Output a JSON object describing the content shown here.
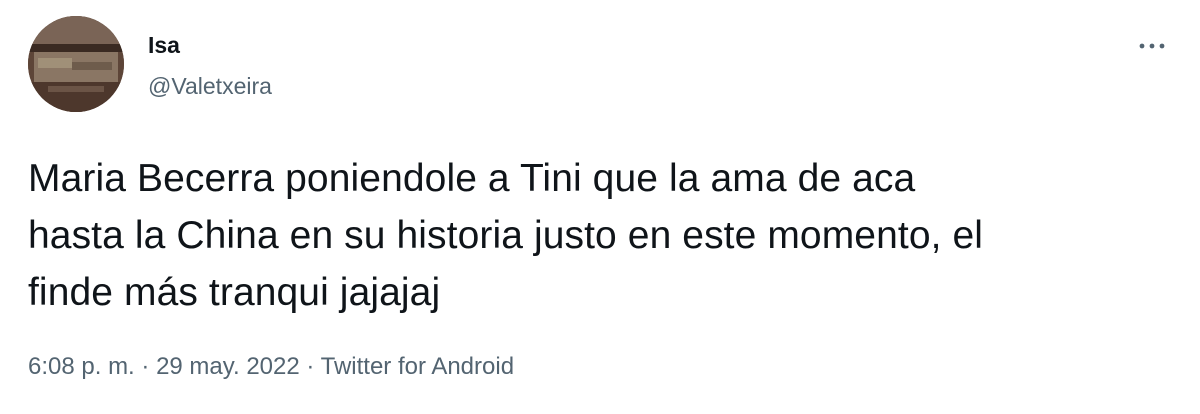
{
  "tweet": {
    "author": {
      "display_name": "Isa",
      "handle": "@Valetxeira",
      "avatar_icon": "user-avatar"
    },
    "more_icon": "more-dots-icon",
    "text": "Maria Becerra poniendole a Tini que la ama de aca\nhasta la China en su historia justo en este momento, el\nfinde más tranqui jajajaj",
    "meta": {
      "time": "6:08 p. m.",
      "separator_1": " · ",
      "date": "29 may. 2022",
      "separator_2": " · ",
      "source": "Twitter for Android"
    }
  },
  "colors": {
    "primary_text": "#0f1419",
    "secondary_text": "#536471",
    "background": "#ffffff"
  }
}
